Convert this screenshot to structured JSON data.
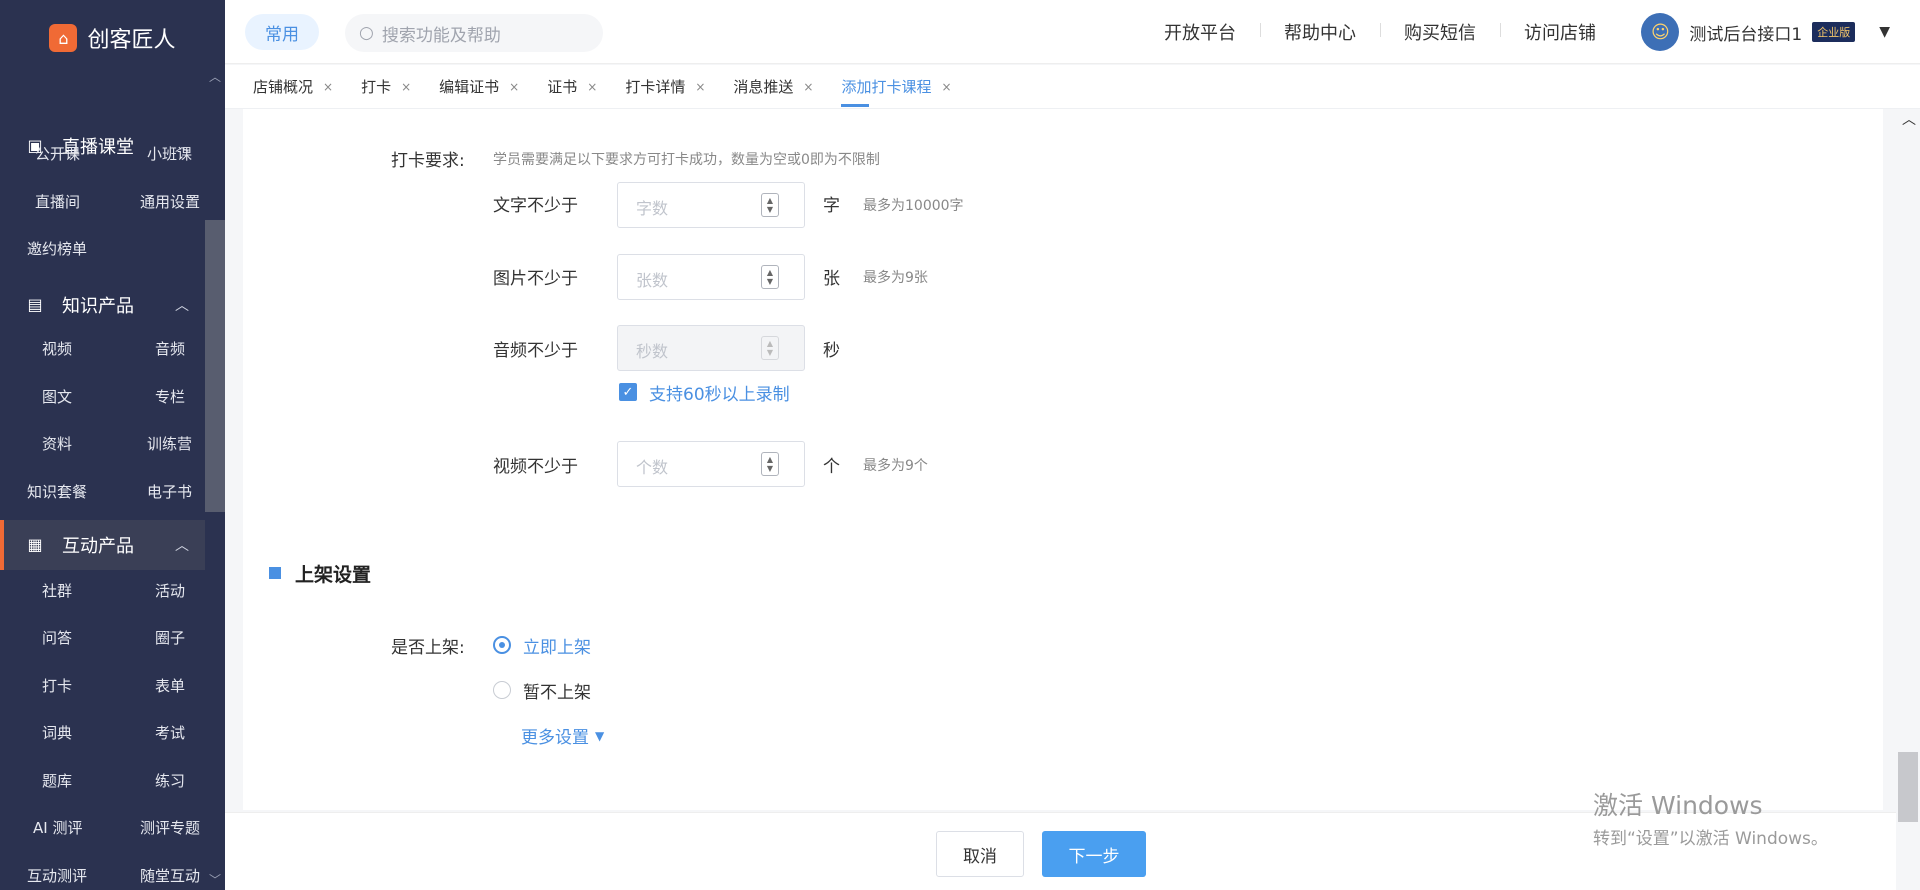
{
  "app": {
    "logo_text": "创客匠人",
    "logo_icon": "house-icon"
  },
  "sidebar": {
    "sections": [
      {
        "label": "直播课堂",
        "icon": "live-camera-icon",
        "items": [
          "公开课",
          "小班课",
          "直播间",
          "通用设置",
          "邀约榜单"
        ]
      },
      {
        "label": "知识产品",
        "icon": "book-icon",
        "items": [
          "视频",
          "音频",
          "图文",
          "专栏",
          "资料",
          "训练营",
          "知识套餐",
          "电子书"
        ]
      },
      {
        "label": "互动产品",
        "icon": "grid-icon",
        "active": true,
        "items": [
          "社群",
          "活动",
          "问答",
          "圈子",
          "打卡",
          "表单",
          "词典",
          "考试",
          "题库",
          "练习",
          "AI 测评",
          "测评专题",
          "互动测评",
          "随堂互动"
        ]
      }
    ],
    "accent_color": "#f06a35"
  },
  "topbar": {
    "common_label": "常用",
    "search_placeholder": "搜索功能及帮助",
    "links": [
      "开放平台",
      "帮助中心",
      "购买短信",
      "访问店铺"
    ],
    "user_name": "测试后台接口1",
    "user_badge": "企业版"
  },
  "tabs": [
    {
      "label": "店铺概况"
    },
    {
      "label": "打卡"
    },
    {
      "label": "编辑证书"
    },
    {
      "label": "证书"
    },
    {
      "label": "打卡详情"
    },
    {
      "label": "消息推送"
    },
    {
      "label": "添加打卡课程",
      "active": true
    }
  ],
  "form": {
    "requirements_label": "打卡要求:",
    "requirements_hint": "学员需要满足以下要求方可打卡成功，数量为空或0即为不限制",
    "text_min": {
      "label": "文字不少于",
      "placeholder": "字数",
      "unit": "字",
      "hint": "最多为10000字"
    },
    "image_min": {
      "label": "图片不少于",
      "placeholder": "张数",
      "unit": "张",
      "hint": "最多为9张"
    },
    "audio_min": {
      "label": "音频不少于",
      "placeholder": "秒数",
      "unit": "秒",
      "disabled": true
    },
    "audio_long_checkbox": {
      "label": "支持60秒以上录制",
      "checked": true
    },
    "video_min": {
      "label": "视频不少于",
      "placeholder": "个数",
      "unit": "个",
      "hint": "最多为9个"
    },
    "listing_section_title": "上架设置",
    "listing_label": "是否上架:",
    "listing_options": [
      {
        "label": "立即上架",
        "selected": true
      },
      {
        "label": "暂不上架",
        "selected": false
      }
    ],
    "more_settings": "更多设置"
  },
  "footer": {
    "cancel": "取消",
    "next": "下一步"
  },
  "watermark": {
    "line1": "激活 Windows",
    "line2": "转到“设置”以激活 Windows。"
  },
  "colors": {
    "primary": "#4a90e2",
    "sidebar_bg": "#2b3250"
  }
}
